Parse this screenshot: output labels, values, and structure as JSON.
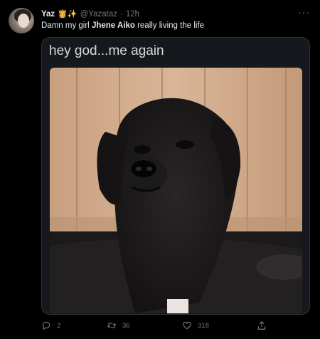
{
  "tweet": {
    "display_name": "Yaz",
    "name_emojis": "👸✨",
    "handle": "@Yazataz",
    "separator": "·",
    "time": "12h",
    "more_label": "···",
    "text_before": "Damn my girl ",
    "text_bold": "Jhene Aiko",
    "text_after": " really living the life"
  },
  "media": {
    "caption": "hey god...me again"
  },
  "actions": {
    "reply_count": "2",
    "retweet_count": "36",
    "like_count": "318"
  },
  "colors": {
    "background": "#000000",
    "text": "#e7e9ea",
    "secondary_text": "#71767b",
    "border": "#2f3336"
  },
  "icons": [
    "reply-icon",
    "retweet-icon",
    "heart-icon",
    "share-icon",
    "more-icon"
  ]
}
